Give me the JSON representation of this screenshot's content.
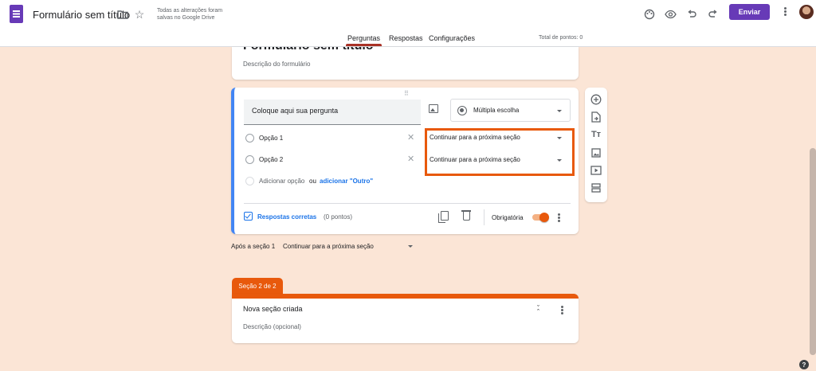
{
  "header": {
    "title": "Formulário sem título",
    "save_status": "Todas as alterações foram salvas no Google Drive",
    "send_label": "Enviar",
    "icons": [
      "folder-icon",
      "star-icon",
      "palette-icon",
      "preview-icon",
      "undo-icon",
      "redo-icon",
      "more-icon"
    ]
  },
  "tabs": [
    {
      "label": "Perguntas",
      "active": true
    },
    {
      "label": "Respostas",
      "active": false
    },
    {
      "label": "Configurações",
      "active": false
    }
  ],
  "total_points": "Total de pontos: 0",
  "form": {
    "title": "Formulário sem título",
    "description_placeholder": "Descrição do formulário"
  },
  "question": {
    "title": "Coloque aqui sua pergunta",
    "type": "Múltipla escolha",
    "options": [
      {
        "label": "Opção 1",
        "goto": "Continuar para a próxima seção"
      },
      {
        "label": "Opção 2",
        "goto": "Continuar para a próxima seção"
      }
    ],
    "add_option": "Adicionar opção",
    "add_or": "ou",
    "add_other": "adicionar \"Outro\"",
    "correct_answers": "Respostas corretas",
    "points": "(0 pontos)",
    "required_label": "Obrigatória",
    "required": true
  },
  "after_section": {
    "label": "Após a seção 1",
    "goto": "Continuar para a próxima seção"
  },
  "section2": {
    "tab_label": "Seção 2 de 2",
    "title": "Nova seção criada",
    "description_placeholder": "Descrição (opcional)"
  },
  "toolbar": {
    "icons": [
      "add-question-icon",
      "import-icon",
      "add-title-icon",
      "add-image-icon",
      "add-video-icon",
      "add-section-icon"
    ]
  },
  "colors": {
    "background": "#fbe5d6",
    "forms_purple": "#673ab7",
    "accent_orange": "#e8590c",
    "question_blue": "#4285f4"
  }
}
